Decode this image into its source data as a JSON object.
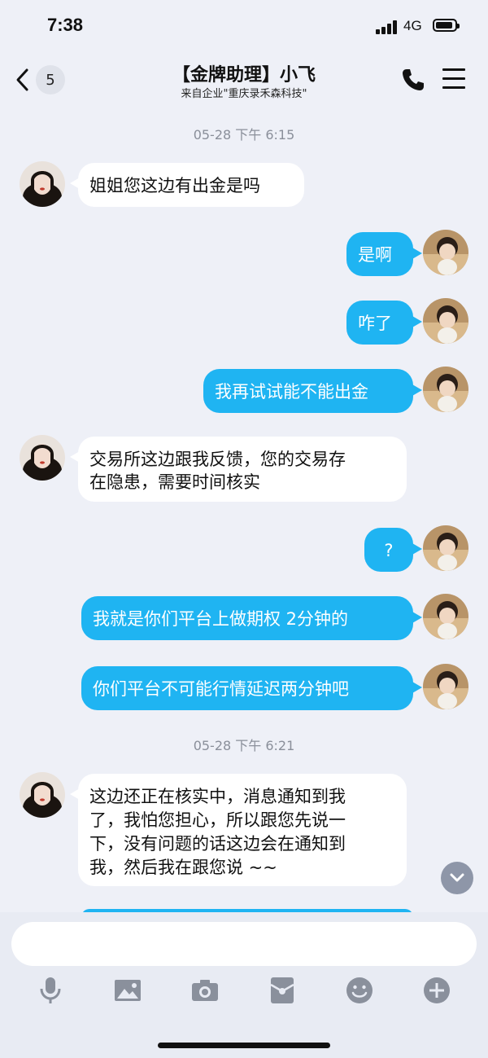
{
  "status_bar": {
    "time": "7:38",
    "network": "4G"
  },
  "header": {
    "back_count": "5",
    "title": "【金牌助理】小飞",
    "subtitle": "来自企业\"重庆录禾森科技\""
  },
  "timestamps": [
    "05-28 下午 6:15",
    "05-28 下午 6:21"
  ],
  "messages": [
    {
      "side": "in",
      "text": "姐姐您这边有出金是吗"
    },
    {
      "side": "out",
      "text": "是啊"
    },
    {
      "side": "out",
      "text": "咋了"
    },
    {
      "side": "out",
      "text": "我再试试能不能出金"
    },
    {
      "side": "in",
      "lines": [
        "交易所这边跟我反馈，您的交易存",
        "在隐患，需要时间核实"
      ]
    },
    {
      "side": "out",
      "text": "?"
    },
    {
      "side": "out",
      "text": "我就是你们平台上做期权 2分钟的"
    },
    {
      "side": "out",
      "text": "你们平台不可能行情延迟两分钟吧"
    },
    {
      "side": "in",
      "lines": [
        "这边还正在核实中，消息通知到我",
        "了，我怕您担心，所以跟您先说一",
        "下，没有问题的话这边会在通知到",
        "我，然后我在跟您说 ~~"
      ]
    }
  ],
  "input": {
    "placeholder": ""
  },
  "toolbar": [
    "mic-icon",
    "image-icon",
    "camera-icon",
    "red-packet-icon",
    "emoji-icon",
    "plus-icon"
  ],
  "colors": {
    "outgoing_bubble": "#1fb4f2",
    "incoming_bubble": "#ffffff",
    "background": "#eef0f7"
  }
}
